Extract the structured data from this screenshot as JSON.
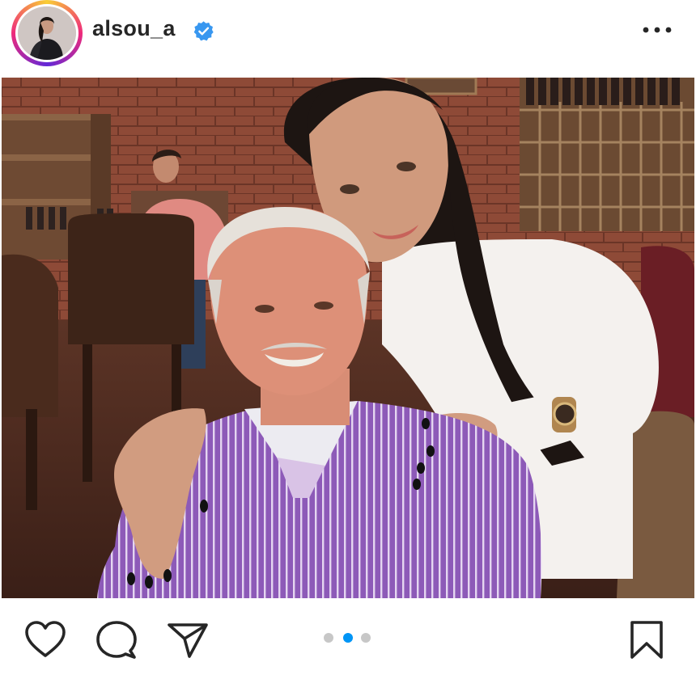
{
  "post": {
    "username": "alsou_a",
    "verified": true,
    "carousel": {
      "total": 3,
      "active_index": 1
    }
  },
  "icons": {
    "avatar": "profile-photo",
    "verified": "verified-badge-icon",
    "more": "more-options-icon",
    "like": "heart-icon",
    "comment": "comment-bubble-icon",
    "share": "paper-plane-icon",
    "save": "bookmark-icon"
  },
  "colors": {
    "verified": "#3897f0",
    "active_dot": "#0095f6",
    "inactive_dot": "#c7c7c7",
    "text": "#262626"
  }
}
